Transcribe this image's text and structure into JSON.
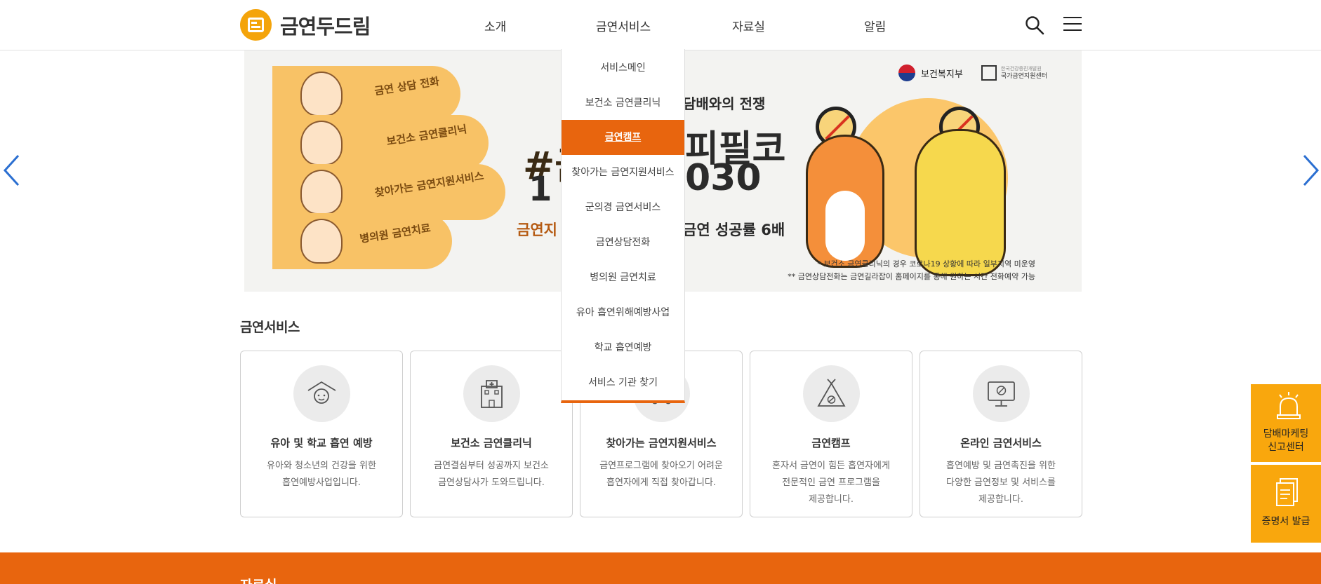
{
  "site": {
    "logo_text": "금연두드림"
  },
  "nav": [
    "소개",
    "금연서비스",
    "자료실",
    "알림"
  ],
  "dropdown": {
    "items": [
      "서비스메인",
      "보건소 금연클리닉",
      "금연캠프",
      "찾아가는 금연지원서비스",
      "군의경 금연서비스",
      "금연상담전화",
      "병의원 금연치료",
      "유아 흡연위해예방사업",
      "학교 흡연예방",
      "서비스 기관 찾기"
    ],
    "active": "금연캠프"
  },
  "banner": {
    "pills": [
      "금연 상담 전화",
      "보건소 금연클리닉",
      "찾아가는 금연지원서비스",
      "병의원 금연치료"
    ],
    "headline": "담배와의 전쟁",
    "hashtag": "#금",
    "big_left": "1",
    "big_right": "피필코",
    "big_num": "030",
    "sub_left": "금연지",
    "sub_right": "금연 성공률 6배",
    "ministry": "보건복지부",
    "center": "국가금연지원센터",
    "center_small": "한국건강증진개발원",
    "notes": [
      "* 보건소 금연클리닉의 경우 코로나19 상황에 따라 일부지역 미운영",
      "** 금연상담전화는 금연길라잡이 홈페이지를 통해 원하는 시간 전화예약 가능"
    ]
  },
  "services": {
    "title": "금연서비스",
    "cards": [
      {
        "title": "유아 및 학교 흡연 예방",
        "desc": [
          "유아와 청소년의 건강을 위한",
          "흡연예방사업입니다."
        ],
        "icon": "child-icon"
      },
      {
        "title": "보건소 금연클리닉",
        "desc": [
          "금연결심부터 성공까지 보건소",
          "금연상담사가 도와드립니다."
        ],
        "icon": "hospital-icon"
      },
      {
        "title": "찾아가는 금연지원서비스",
        "desc": [
          "금연프로그램에 찾아오기 어려운",
          "흡연자에게 직접 찾아갑니다."
        ],
        "icon": "car-icon"
      },
      {
        "title": "금연캠프",
        "desc": [
          "혼자서 금연이 힘든 흡연자에게",
          "전문적인 금연 프로그램을",
          "제공합니다."
        ],
        "icon": "tent-icon"
      },
      {
        "title": "온라인 금연서비스",
        "desc": [
          "흡연예방 및 금연촉진을 위한",
          "다양한 금연정보 및 서비스를",
          "제공합니다."
        ],
        "icon": "monitor-icon"
      }
    ]
  },
  "quick_menu": [
    {
      "label_1": "담배마케팅",
      "label_2": "신고센터",
      "icon": "siren-icon"
    },
    {
      "label_1": "증명서 발급",
      "label_2": "",
      "icon": "document-icon"
    }
  ],
  "bottom_section": {
    "title": "자료실"
  },
  "colors": {
    "accent": "#e8650e",
    "quick": "#f9a70d",
    "logo": "#f4a40b",
    "arrow": "#2b6fd1"
  }
}
